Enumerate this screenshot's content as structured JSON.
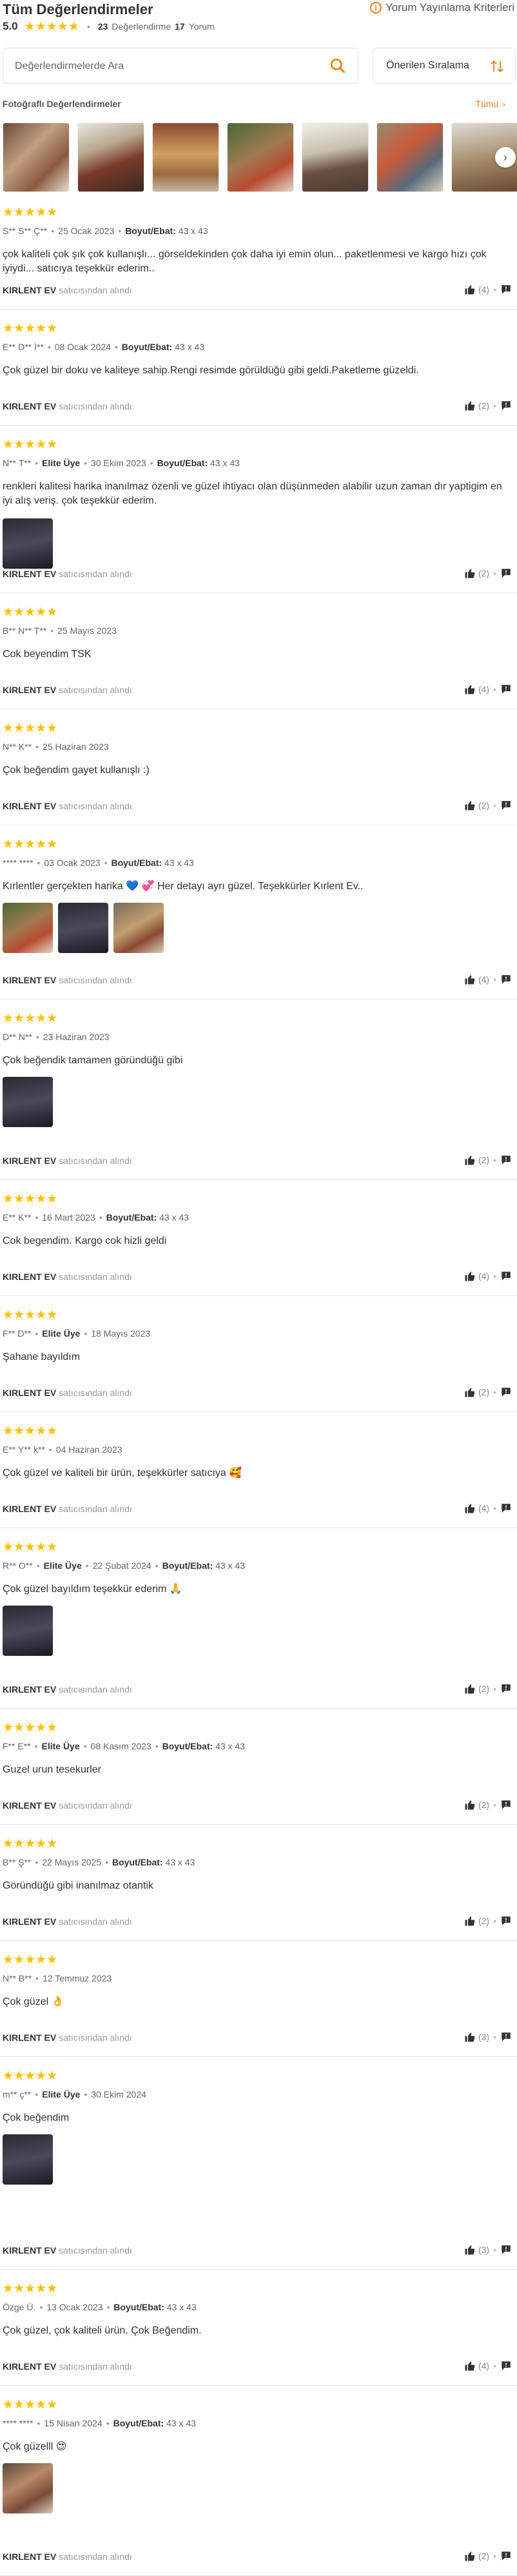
{
  "header": {
    "title": "Tüm Değerlendirmeler",
    "criteria_link": "Yorum Yayınlama Kriterleri",
    "average": "5.0",
    "rating_count": "23",
    "rating_label": "Değerlendirme",
    "review_count": "17",
    "review_label": "Yorum"
  },
  "search": {
    "placeholder": "Değerlendirmelerde Ara"
  },
  "sort": {
    "label": "Önerilen Sıralama"
  },
  "photos": {
    "title": "Fotoğraflı Değerlendirmeler",
    "see_all": "Tümü"
  },
  "size_label": "Boyut/Ebat:",
  "seller_suffix": "satıcısından alındı",
  "elite_label": "Elite Üye",
  "colors": {
    "accent": "#f27a1a",
    "star": "#ffc000"
  },
  "reviews": [
    {
      "user": "S** S** Ç**",
      "date": "25 Ocak 2023",
      "size": "43 x 43",
      "text": "çok kaliteli çok şık çok kullanışlı... görseldekinden çok daha iyi emin olun... paketlenmesi ve kargo hızı çok iyiydi... satıcıya teşekkür ederim..",
      "seller": "KIRLENT EV",
      "likes": "(4)"
    },
    {
      "user": "E** D** İ**",
      "date": "08 Ocak 2024",
      "size": "43 x 43",
      "text": "Çok güzel bir doku ve kaliteye sahip.Rengi resimde görüldüğü gibi geldi.Paketleme güzeldi.",
      "seller": "KIRLENT EV",
      "likes": "(2)"
    },
    {
      "user": "N** T**",
      "elite": true,
      "date": "30 Ekim 2023",
      "size": "43 x 43",
      "text": "renkleri kalitesi harika inanılmaz özenli ve güzel ihtiyacı olan düşünmeden alabilir uzun zaman dır yaptigim en iyi alış veriş. çok teşekkür ederim.",
      "seller": "KIRLENT EV",
      "likes": "(2)"
    },
    {
      "user": "B** N** T**",
      "date": "25 Mayıs 2023",
      "text": "Cok beyendim TSK",
      "seller": "KIRLENT EV",
      "likes": "(4)"
    },
    {
      "user": "N** K**",
      "date": "25 Haziran 2023",
      "text": "Çok beğendim gayet kullanışlı :)",
      "seller": "KIRLENT EV",
      "likes": "(2)"
    },
    {
      "user": "**** ****",
      "date": "03 Ocak 2023",
      "size": "43 x 43",
      "text": "Kırlentler gerçekten harika 💙 💞 Her detayı ayrı güzel. Teşekkürler Kırlent Ev..",
      "seller": "KIRLENT EV",
      "likes": "(4)"
    },
    {
      "user": "D** N**",
      "date": "23 Haziran 2023",
      "text": "Çok beğendik tamamen göründüğü gibi",
      "seller": "KIRLENT EV",
      "likes": "(2)"
    },
    {
      "user": "E** K**",
      "date": "16 Mart 2023",
      "size": "43 x 43",
      "text": "Cok begendim. Kargo cok hizli geldi",
      "seller": "KIRLENT EV",
      "likes": "(4)"
    },
    {
      "user": "F** D**",
      "elite": true,
      "date": "18 Mayıs 2023",
      "text": "Şahane bayıldım",
      "seller": "KIRLENT EV",
      "likes": "(2)"
    },
    {
      "user": "E** Y** k**",
      "date": "04 Haziran 2023",
      "text": "Çok güzel ve kaliteli bir ürün, teşekkürler satıcıya 🥰",
      "seller": "KIRLENT EV",
      "likes": "(4)"
    },
    {
      "user": "R** O**",
      "elite": true,
      "date": "22 Şubat 2024",
      "size": "43 x 43",
      "text": "Çok güzel bayıldım teşekkür ederim 🙏",
      "seller": "KIRLENT EV",
      "likes": "(2)"
    },
    {
      "user": "F** E**",
      "elite": true,
      "date": "08 Kasım 2023",
      "size": "43 x 43",
      "text": "Guzel urun tesekurler",
      "seller": "KIRLENT EV",
      "likes": "(2)"
    },
    {
      "user": "B** Ş**",
      "date": "22 Mayıs 2025",
      "size": "43 x 43",
      "text": "Göründüğü gibi inanılmaz otantik",
      "seller": "KIRLENT EV",
      "likes": "(2)"
    },
    {
      "user": "N** B**",
      "date": "12 Temmuz 2023",
      "text": "Çok güzel 👌",
      "seller": "KIRLENT EV",
      "likes": "(3)"
    },
    {
      "user": "m** ç**",
      "elite": true,
      "date": "30 Ekim 2024",
      "text": "Çok beğendim",
      "seller": "KIRLENT EV",
      "likes": "(3)"
    },
    {
      "user": "Özge Ü.",
      "date": "13 Ocak 2023",
      "size": "43 x 43",
      "text": "Çok güzel, çok kaliteli ürün. Çok Beğendim.",
      "seller": "KIRLENT EV",
      "likes": "(4)"
    },
    {
      "user": "**** ****",
      "date": "15 Nisan 2024",
      "size": "43 x 43",
      "text": "Çok güzelll 😍",
      "seller": "KIRLENT EV",
      "likes": "(2)"
    }
  ]
}
